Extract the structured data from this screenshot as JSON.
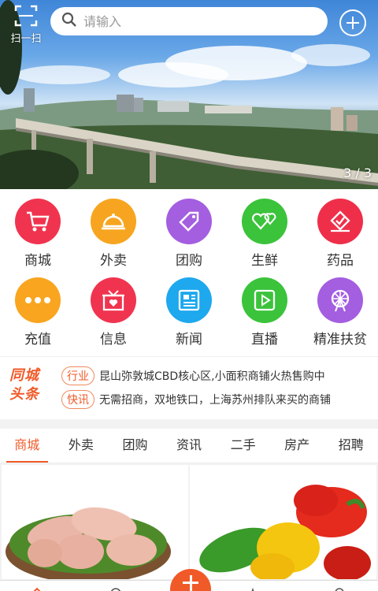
{
  "header": {
    "scan_label": "扫一扫",
    "search_placeholder": "请输入",
    "add_icon": "plus-circle-icon",
    "banner_counter": "3 / 3"
  },
  "categories": [
    {
      "label": "商城",
      "icon": "shopping-cart-icon",
      "color": "#f0344f"
    },
    {
      "label": "外卖",
      "icon": "food-cloche-icon",
      "color": "#f7a520"
    },
    {
      "label": "团购",
      "icon": "tag-icon",
      "color": "#a45ee0"
    },
    {
      "label": "生鲜",
      "icon": "hearts-icon",
      "color": "#3bc33b"
    },
    {
      "label": "药品",
      "icon": "medicine-box-icon",
      "color": "#ef2f4a"
    },
    {
      "label": "充值",
      "icon": "dots-icon",
      "color": "#f9a51f"
    },
    {
      "label": "信息",
      "icon": "gift-box-icon",
      "color": "#f0344f"
    },
    {
      "label": "新闻",
      "icon": "newspaper-icon",
      "color": "#1ea8ee"
    },
    {
      "label": "直播",
      "icon": "play-icon",
      "color": "#3bc33b"
    },
    {
      "label": "精准扶贫",
      "icon": "ferris-wheel-icon",
      "color": "#a45ee0"
    }
  ],
  "news": {
    "logo_line1": "同城",
    "logo_line2": "头条",
    "items": [
      {
        "tag": "行业",
        "text": "昆山弥敦城CBD核心区,小面积商铺火热售购中"
      },
      {
        "tag": "快讯",
        "text": "无需招商，双地铁口，上海苏州排队来买的商铺"
      }
    ]
  },
  "tabs": [
    "商城",
    "外卖",
    "团购",
    "资讯",
    "二手",
    "房产",
    "招聘"
  ],
  "active_tab": "商城",
  "colors": {
    "accent": "#f05a28"
  }
}
